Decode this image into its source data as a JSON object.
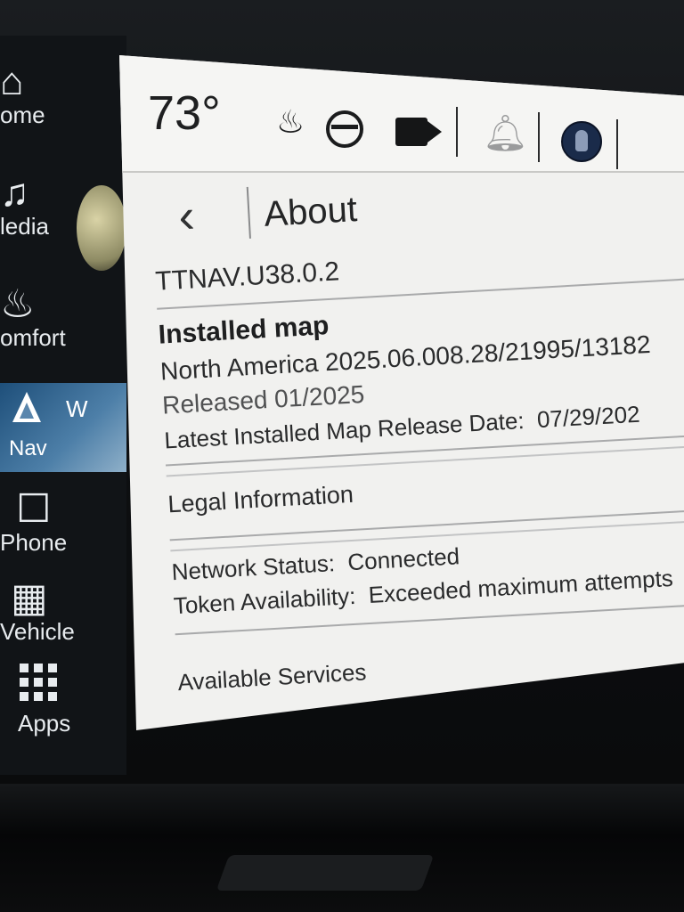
{
  "sidebar": {
    "items": [
      {
        "label": "ome",
        "icon": "home-icon"
      },
      {
        "label": "ledia",
        "icon": "music-note-icon"
      },
      {
        "label": "omfort",
        "icon": "seat-comfort-icon"
      },
      {
        "label": "Nav",
        "icon": "navigation-arrow-icon",
        "compass": "W",
        "active": true
      },
      {
        "label": "Phone",
        "icon": "phone-icon"
      },
      {
        "label": "Vehicle",
        "icon": "jeep-icon"
      },
      {
        "label": "Apps",
        "icon": "apps-grid-icon"
      }
    ]
  },
  "status_bar": {
    "temperature": "73°",
    "icons": [
      "heated-seat-icon",
      "heated-wheel-icon",
      "camera-icon",
      "bell-icon",
      "profile-icon"
    ]
  },
  "about": {
    "title": "About",
    "version": "TTNAV.U38.0.2",
    "installed_map_heading": "Installed map",
    "map_name": "North America 2025.06.008.28/21995/13182",
    "released": "Released 01/2025",
    "latest_release_label": "Latest Installed Map Release Date:",
    "latest_release_value": "07/29/202",
    "legal": "Legal Information",
    "network_label": "Network Status:",
    "network_value": "Connected",
    "token_label": "Token Availability:",
    "token_value": "Exceeded maximum attempts",
    "services": "Available Services"
  },
  "colors": {
    "screen_bg": "#f1f1ef",
    "sidebar_bg": "#111417",
    "nav_active": "#4d7fa8",
    "text": "#2a2b2c"
  }
}
